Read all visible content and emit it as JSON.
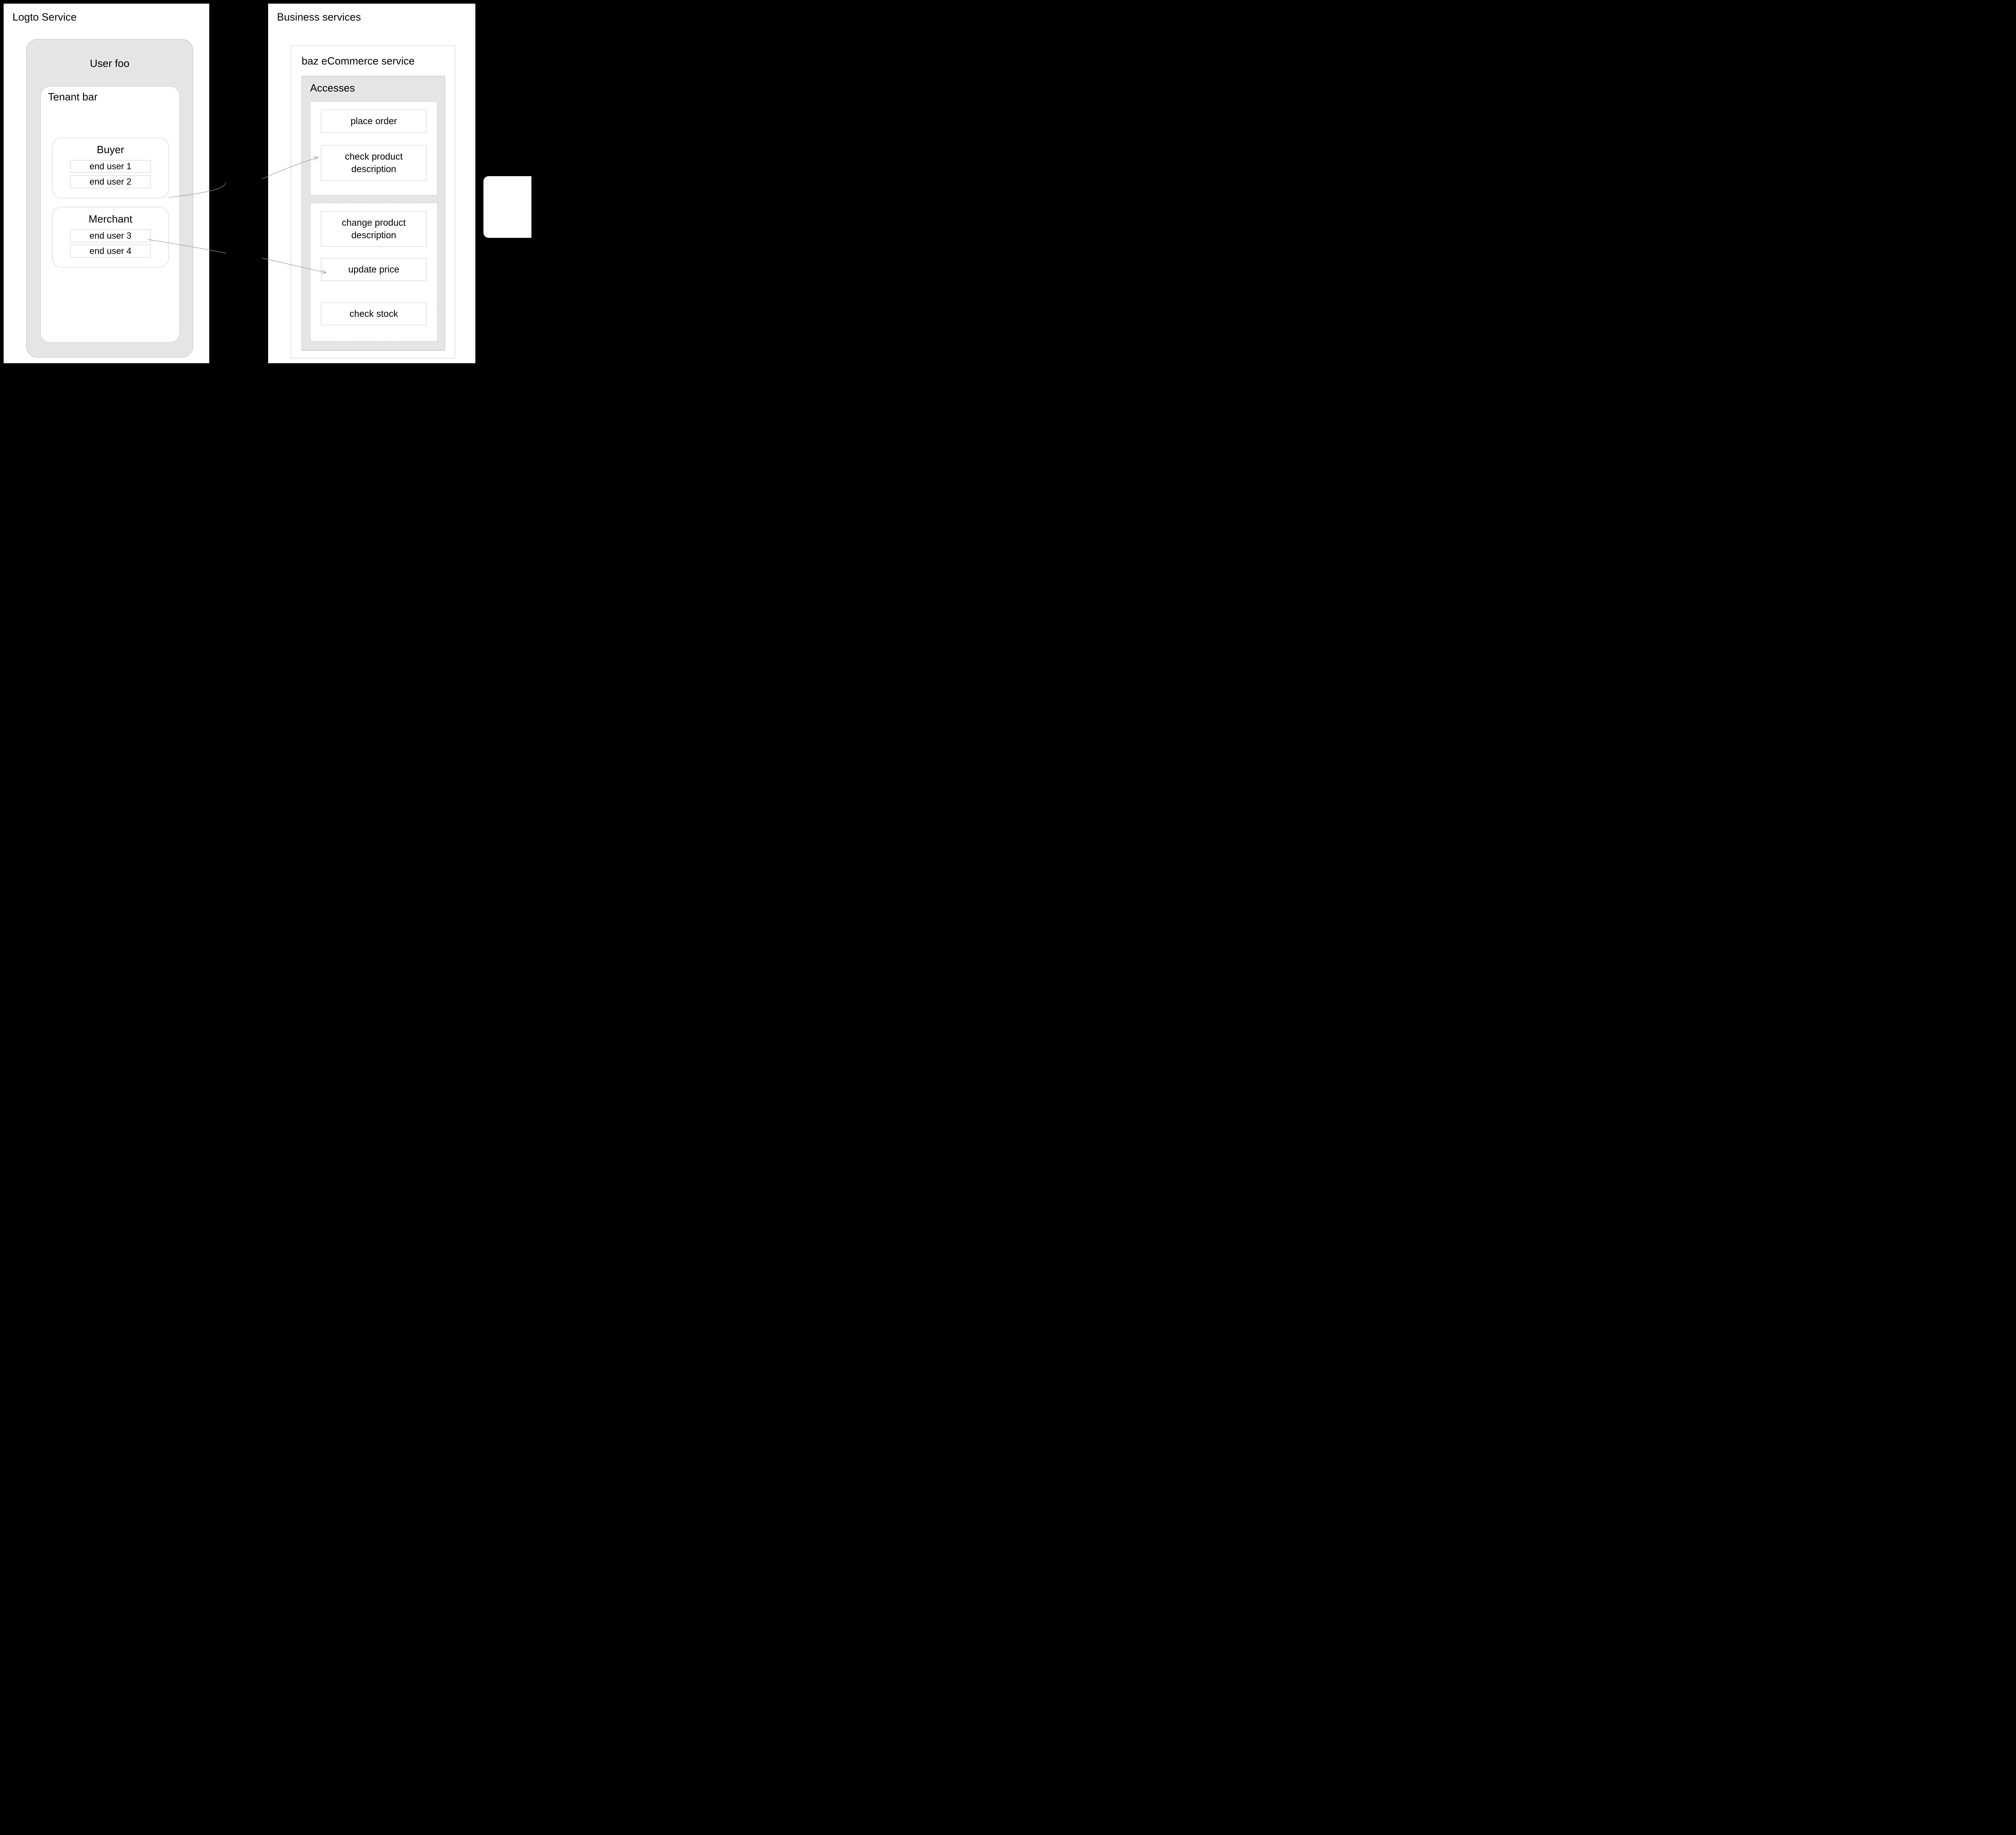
{
  "left": {
    "title": "Logto Service",
    "user": {
      "name": "User foo",
      "tenant": {
        "name": "Tenant bar",
        "roles": {
          "buyer": {
            "name": "Buyer",
            "users": [
              "end user 1",
              "end user 2"
            ]
          },
          "merchant": {
            "name": "Merchant",
            "users": [
              "end user 3",
              "end user 4"
            ]
          }
        }
      }
    }
  },
  "right": {
    "title": "Business services",
    "service": {
      "name": "baz eCommerce service",
      "accesses": {
        "title": "Accesses",
        "group_buyer": [
          "place order",
          "check product description"
        ],
        "group_merchant": [
          "change product description",
          "update price",
          "check stock"
        ]
      }
    }
  }
}
